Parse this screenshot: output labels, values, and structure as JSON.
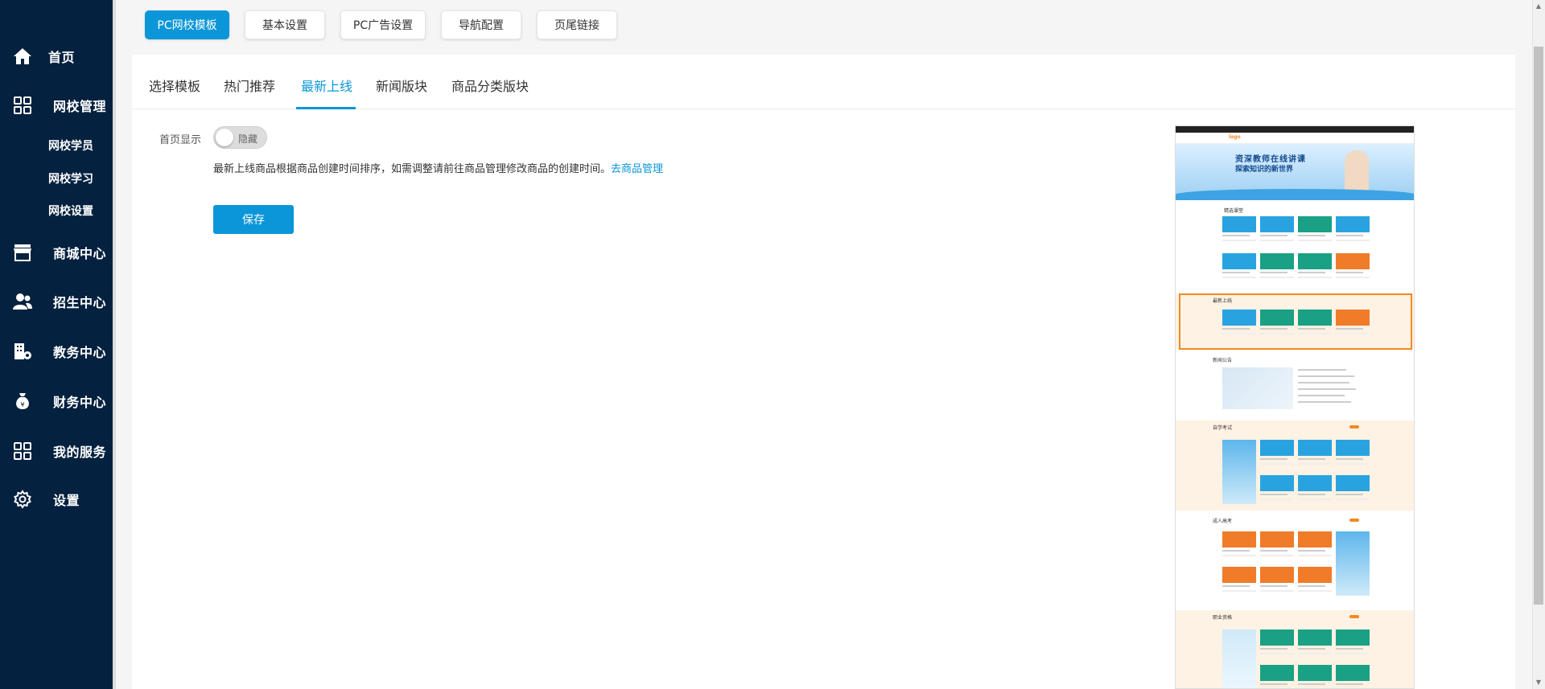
{
  "sidebar": {
    "items": [
      {
        "label": "首页",
        "icon": "home-icon"
      },
      {
        "label": "网校管理",
        "icon": "grid-icon"
      },
      {
        "label": "商城中心",
        "icon": "store-icon"
      },
      {
        "label": "招生中心",
        "icon": "users-icon"
      },
      {
        "label": "教务中心",
        "icon": "building-icon"
      },
      {
        "label": "财务中心",
        "icon": "money-bag-icon"
      },
      {
        "label": "我的服务",
        "icon": "grid-icon"
      },
      {
        "label": "设置",
        "icon": "gear-icon"
      }
    ],
    "subitems": [
      "网校学员",
      "网校学习",
      "网校设置"
    ]
  },
  "topbar": {
    "buttons": [
      "PC网校模板",
      "基本设置",
      "PC广告设置",
      "导航配置",
      "页尾链接"
    ],
    "active": "PC网校模板"
  },
  "tabs": {
    "items": [
      "选择模板",
      "热门推荐",
      "最新上线",
      "新闻版块",
      "商品分类版块"
    ],
    "active": "最新上线"
  },
  "form": {
    "label": "首页显示",
    "toggle_text": "隐藏",
    "toggle_on": false,
    "hint": "最新上线商品根据商品创建时间排序，如需调整请前往商品管理修改商品的创建时间。",
    "hint_link": "去商品管理",
    "save_label": "保存"
  },
  "preview": {
    "logo": "logo",
    "banner_line1": "资深教师在线讲课",
    "banner_line2": "探索知识的新世界",
    "sections": [
      "精选课堂",
      "最新上线",
      "新闻公告",
      "自学考试",
      "成人高考",
      "职业资格"
    ]
  },
  "colors": {
    "sidebar_bg": "#04213f",
    "accent": "#0a96d8",
    "highlight": "#f08a24"
  }
}
